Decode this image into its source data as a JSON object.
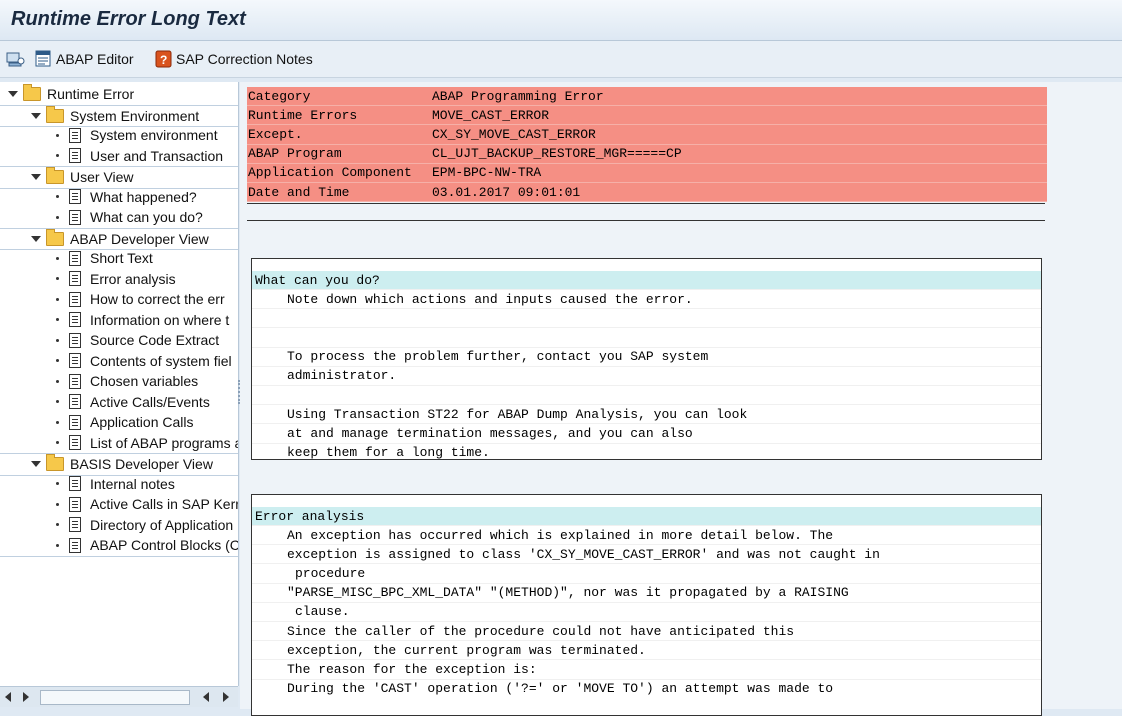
{
  "window": {
    "title": "Runtime Error Long Text"
  },
  "toolbar": {
    "icon1": "overview-icon",
    "abap_editor": "ABAP Editor",
    "sap_notes": "SAP Correction Notes"
  },
  "tree": {
    "root": "Runtime Error",
    "sys_env_group": "System Environment",
    "sys_env": "System environment",
    "user_trans": "User and Transaction",
    "user_view_group": "User View",
    "what_happened": "What happened?",
    "what_can_you_do": "What can you do?",
    "abap_dev_group": "ABAP Developer View",
    "short_text": "Short Text",
    "error_analysis": "Error analysis",
    "how_to_correct": "How to correct the err",
    "info_where": "Information on where t",
    "source_code": "Source Code Extract",
    "contents_sys": "Contents of system fiel",
    "chosen_vars": "Chosen variables",
    "active_calls": "Active Calls/Events",
    "app_calls": "Application Calls",
    "list_abap": "List of ABAP programs a",
    "basis_dev_group": "BASIS Developer View",
    "internal_notes": "Internal notes",
    "active_calls_kern": "Active Calls in SAP Kern",
    "directory_app": "Directory of Application",
    "abap_control": "ABAP Control Blocks (C"
  },
  "header": {
    "rows": [
      {
        "k": "Category",
        "v": "ABAP Programming Error"
      },
      {
        "k": "Runtime Errors",
        "v": "MOVE_CAST_ERROR"
      },
      {
        "k": "Except.",
        "v": "CX_SY_MOVE_CAST_ERROR"
      },
      {
        "k": "ABAP Program",
        "v": "CL_UJT_BACKUP_RESTORE_MGR=====CP"
      },
      {
        "k": "Application Component",
        "v": "EPM-BPC-NW-TRA"
      },
      {
        "k": "Date and Time",
        "v": "03.01.2017 09:01:01"
      }
    ]
  },
  "what_can_you_do": {
    "title": "What can you do?",
    "lines": [
      "Note down which actions and inputs caused the error.",
      "",
      "",
      "To process the problem further, contact you SAP system",
      "administrator.",
      "",
      "Using Transaction ST22 for ABAP Dump Analysis, you can look",
      "at and manage termination messages, and you can also",
      "keep them for a long time."
    ]
  },
  "error_analysis": {
    "title": "Error analysis",
    "l0": "An exception has occurred which is explained in more detail below. The",
    "l1": "exception is assigned to class 'CX_SY_MOVE_CAST_ERROR' and was not caught in",
    "l2": "procedure",
    "l3": "\"PARSE_MISC_BPC_XML_DATA\" \"(METHOD)\", nor was it propagated by a RAISING",
    "l4": "clause.",
    "l5": "Since the caller of the procedure could not have anticipated this",
    "l6": "exception, the current program was terminated.",
    "l7": "The reason for the exception is:",
    "l8": "During the 'CAST' operation ('?=' or 'MOVE TO') an attempt was made to"
  }
}
